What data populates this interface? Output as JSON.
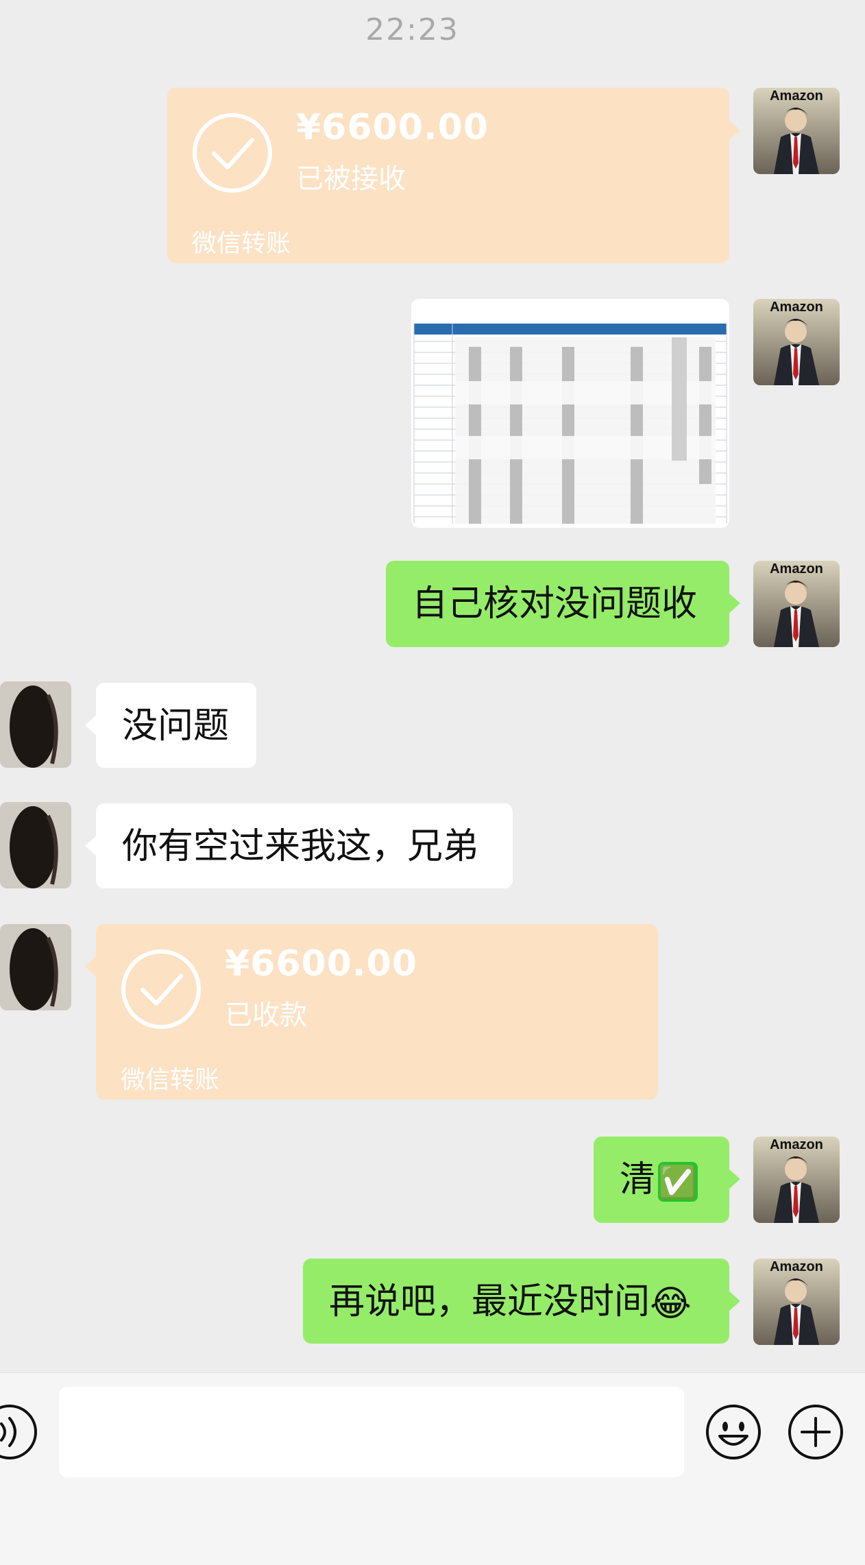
{
  "timestamp": "22:23",
  "colors": {
    "background": "#EDEDED",
    "green_bubble": "#95EC69",
    "transfer_card": "#FCE1C3",
    "white_bubble": "#FFFFFF"
  },
  "self_avatar_label": "Amazon",
  "messages": [
    {
      "side": "right",
      "type": "transfer",
      "amount": "¥6600.00",
      "status": "已被接收",
      "brand": "微信转账"
    },
    {
      "side": "right",
      "type": "image",
      "description_icon": "spreadsheet-image"
    },
    {
      "side": "right",
      "type": "text",
      "text": "自己核对没问题收"
    },
    {
      "side": "left",
      "type": "text",
      "text": "没问题"
    },
    {
      "side": "left",
      "type": "text",
      "text": "你有空过来我这，兄弟"
    },
    {
      "side": "left",
      "type": "transfer",
      "amount": "¥6600.00",
      "status": "已收款",
      "brand": "微信转账"
    },
    {
      "side": "right",
      "type": "text",
      "text": "清",
      "emoji": "✅"
    },
    {
      "side": "right",
      "type": "text",
      "text": "再说吧，最近没时间",
      "emoji": "😂"
    }
  ],
  "input_bar": {
    "voice_icon": "voice-icon",
    "emoji_icon": "smiley-icon",
    "plus_icon": "plus-icon"
  }
}
